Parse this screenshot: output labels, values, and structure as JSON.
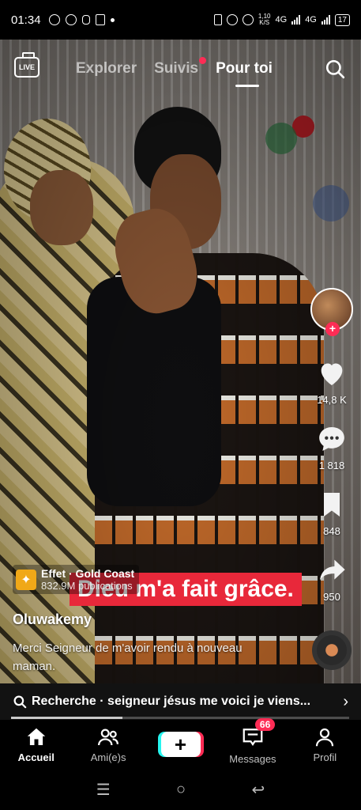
{
  "status_bar": {
    "time": "01:34",
    "net_speed": "1,10",
    "net_speed_unit": "K/S",
    "net1": "4G",
    "net2": "4G",
    "battery": "17"
  },
  "top_nav": {
    "live_label": "LIVE",
    "tabs": [
      {
        "label": "Explorer",
        "active": false
      },
      {
        "label": "Suivis",
        "active": false,
        "has_dot": true
      },
      {
        "label": "Pour toi",
        "active": true
      }
    ]
  },
  "video": {
    "overlay_text": "Dieu m'a fait grâce."
  },
  "rail": {
    "likes": "14,8 K",
    "comments": "1 818",
    "saves": "848",
    "shares": "950"
  },
  "caption": {
    "effect_title": "Effet · Gold Coast",
    "effect_sub": "832.9M publications",
    "username": "Oluwakemy",
    "description": "Merci Seigneur de m'avoir rendu à nouveau maman."
  },
  "search_suggestion": {
    "text": "Recherche · seigneur jésus me voici je viens...",
    "progress": 0.33
  },
  "bottom_nav": {
    "items": [
      {
        "label": "Accueil",
        "icon": "home-icon",
        "active": true
      },
      {
        "label": "Ami(e)s",
        "icon": "friends-icon",
        "active": false
      },
      {
        "label": "",
        "icon": "plus-icon",
        "active": false
      },
      {
        "label": "Messages",
        "icon": "inbox-icon",
        "active": false,
        "badge": "66"
      },
      {
        "label": "Profil",
        "icon": "profile-icon",
        "active": false
      }
    ]
  },
  "colors": {
    "accent": "#fe2c55",
    "cyan": "#25f4ee",
    "overlay_red": "#e8283a"
  }
}
